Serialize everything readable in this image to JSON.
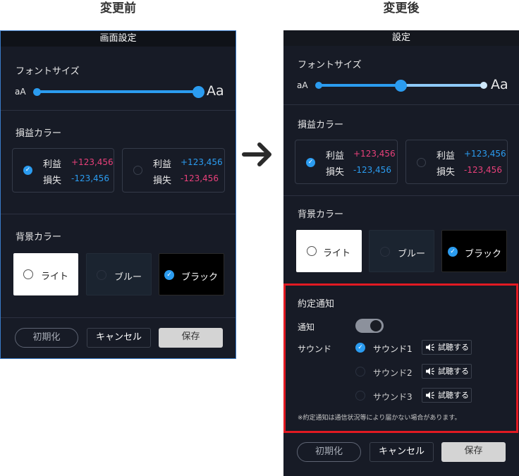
{
  "captions": {
    "before": "変更前",
    "after": "変更後"
  },
  "before": {
    "title": "画面設定",
    "font_size": {
      "label": "フォントサイズ",
      "small": "aA",
      "large": "Aa",
      "level": 1.0
    },
    "pl_color": {
      "label": "損益カラー",
      "options": [
        {
          "profit_label": "利益",
          "profit_value": "+123,456",
          "loss_label": "損失",
          "loss_value": "-123,456",
          "selected": true
        },
        {
          "profit_label": "利益",
          "profit_value": "+123,456",
          "loss_label": "損失",
          "loss_value": "-123,456",
          "selected": false
        }
      ]
    },
    "background": {
      "label": "背景カラー",
      "options": [
        "ライト",
        "ブルー",
        "ブラック"
      ],
      "selected": "ブラック"
    },
    "buttons": {
      "init": "初期化",
      "cancel": "キャンセル",
      "save": "保存"
    }
  },
  "after": {
    "title": "設定",
    "font_size": {
      "label": "フォントサイズ",
      "small": "aA",
      "large": "Aa",
      "level": 0.5
    },
    "pl_color": {
      "label": "損益カラー",
      "options": [
        {
          "profit_label": "利益",
          "profit_value": "+123,456",
          "loss_label": "損失",
          "loss_value": "-123,456",
          "selected": true
        },
        {
          "profit_label": "利益",
          "profit_value": "+123,456",
          "loss_label": "損失",
          "loss_value": "-123,456",
          "selected": false
        }
      ]
    },
    "background": {
      "label": "背景カラー",
      "options": [
        "ライト",
        "ブルー",
        "ブラック"
      ],
      "selected": "ブラック"
    },
    "contract_notice": {
      "label": "約定通知",
      "notify_label": "通知",
      "notify_on": true,
      "sound_label": "サウンド",
      "sounds": [
        "サウンド1",
        "サウンド2",
        "サウンド3"
      ],
      "selected_sound": "サウンド1",
      "try_label": "試聴する",
      "note": "※約定通知は通信状況等により届かない場合があります。"
    },
    "buttons": {
      "init": "初期化",
      "cancel": "キャンセル",
      "save": "保存"
    }
  },
  "colors": {
    "accent": "#2b9cf0",
    "profit": "#e8407a",
    "highlight": "#e11a22",
    "panel": "#171b26"
  },
  "icons": {
    "transition": "arrow-right-icon",
    "check": "check-icon",
    "speaker": "speaker-icon"
  }
}
